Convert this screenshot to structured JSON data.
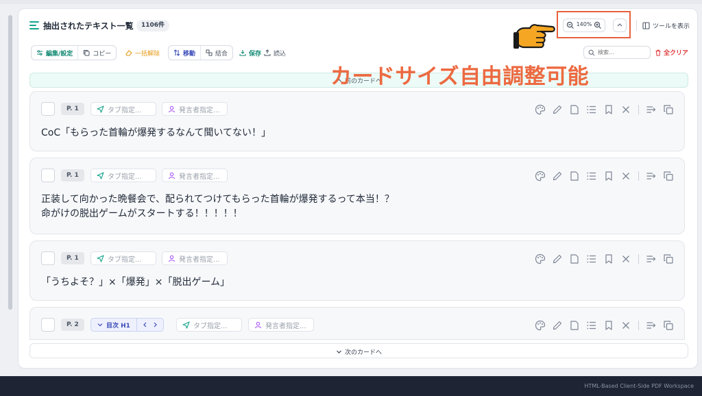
{
  "header": {
    "title": "抽出されたテキスト一覧",
    "count": "1106件",
    "zoom_level": "140%",
    "tool_show_label": "ツールを表示"
  },
  "toolbar": {
    "edit_settings": "編集/設定",
    "copy": "コピー",
    "bulk_release": "一括解除",
    "move": "移動",
    "merge": "結合",
    "save": "保存",
    "load": "読込",
    "search_placeholder": "検索...",
    "clear_all": "全クリア"
  },
  "overlay_caption": "カードサイズ自由調整可能",
  "prev_label": "前のカードへ",
  "next_label": "次のカードへ",
  "cards": [
    {
      "page": "P. 1",
      "tab_placeholder": "タブ指定...",
      "speaker_placeholder": "発言者指定...",
      "lines": [
        "CoC「もらった首輪が爆発するなんて聞いてない！」"
      ]
    },
    {
      "page": "P. 1",
      "tab_placeholder": "タブ指定...",
      "speaker_placeholder": "発言者指定...",
      "lines": [
        "正装して向かった晩餐会で、配られてつけてもらった首輪が爆発するって本当！？",
        "命がけの脱出ゲームがスタートする！！！！！"
      ]
    },
    {
      "page": "P. 1",
      "tab_placeholder": "タブ指定...",
      "speaker_placeholder": "発言者指定...",
      "lines": [
        "「うちよそ？」×「爆発」×「脱出ゲーム」"
      ]
    },
    {
      "page": "P. 2",
      "toc": "目次 H1",
      "tab_placeholder": "タブ指定...",
      "speaker_placeholder": "発言者指定...",
      "lines": []
    }
  ],
  "footer": "HTML-Based Client-Side PDF Workspace",
  "colors": {
    "accent": "#14a38b",
    "highlight": "#e8603c",
    "danger": "#e03b3b",
    "toc": "#3b4bb8"
  },
  "icons": [
    "list-icon",
    "zoom-out-icon",
    "zoom-in-icon",
    "chevron-up-icon",
    "panel-icon",
    "sliders-icon",
    "copy-icon",
    "eraser-icon",
    "move-icon",
    "merge-icon",
    "download-icon",
    "upload-icon",
    "search-icon",
    "trash-icon",
    "send-icon",
    "user-icon",
    "palette-icon",
    "pencil-icon",
    "note-icon",
    "list-lines-icon",
    "bookmark-icon",
    "close-icon",
    "split-icon",
    "duplicate-icon",
    "pointing-hand-icon"
  ]
}
